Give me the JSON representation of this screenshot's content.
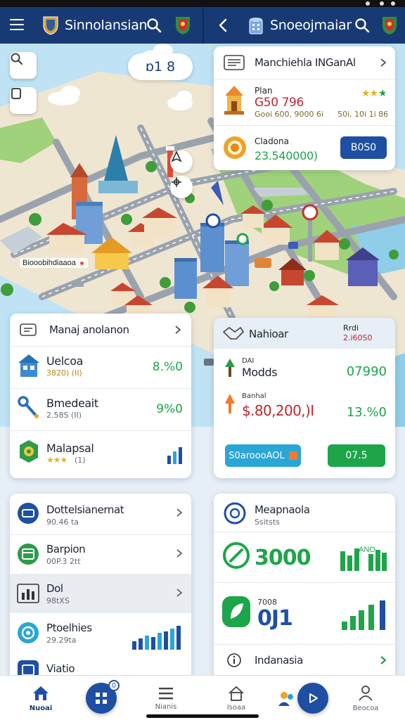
{
  "app": {
    "left_title": "Sinnolansian",
    "right_title": "Snoeojmaiar"
  },
  "map": {
    "zoom_label": "ɒ1 8",
    "place_label": "Biooobihdiaaoa"
  },
  "summary_card": {
    "header": "Manchiehla INGanAl",
    "item1_name": "Plan",
    "item1_value": "G50 796",
    "item1_sub": "Gooi 600, 9000 6i",
    "item1_right": "50i, 10i 1i 86",
    "item2_name": "Cladona",
    "item2_value": "23.540000)",
    "item2_button": "B0S0"
  },
  "manage_card": {
    "header": "Manaj anolanon",
    "rows": [
      {
        "name": "Uelcoa",
        "sub": "3820) (II)",
        "value": "8.%0"
      },
      {
        "name": "Bmedeait",
        "sub": "2.58S (II)",
        "value": "9%0"
      },
      {
        "name": "Malapsal",
        "sub": "(1)",
        "value": ""
      }
    ]
  },
  "nahioar_card": {
    "header": "Nahioar",
    "header_right_top": "Rrdi",
    "header_right_bottom": "2.i60S0",
    "row1_top": "DAI",
    "row1_name": "Modds",
    "row1_value": "07990",
    "row2_top": "Banhal",
    "row2_value": "$.80,200,)I",
    "row2_pct": "13.%0",
    "btn_left": "S0aroooAOL",
    "btn_right": "07.5"
  },
  "list_card": {
    "rows": [
      {
        "name": "Dottelsianernat",
        "sub": "90.46 ta"
      },
      {
        "name": "Barpion",
        "sub": "00P.3 2tt"
      },
      {
        "name": "Dol",
        "sub": "98tXS"
      },
      {
        "name": "Ptoelhies",
        "sub": "29.29ta"
      },
      {
        "name": "Viatio",
        "sub": ""
      }
    ]
  },
  "metrics_card": {
    "header": "Meapnaola",
    "header_sub": "Ssitsts",
    "metric1_value": "3000",
    "metric1_chart_label": "ANO",
    "metric2_top": "7008",
    "metric2_value": "0J1",
    "footer": "Indanasia"
  },
  "bottom_nav": [
    {
      "label": "Nuoai"
    },
    {
      "label": ""
    },
    {
      "label": "Nianis"
    },
    {
      "label": "Isoaa"
    },
    {
      "label": ""
    },
    {
      "label": "Beocoa"
    }
  ],
  "fab_badge": "0",
  "colors": {
    "brand_navy": "#183a74",
    "accent_blue": "#1f4fa3",
    "green": "#1ea54a",
    "red": "#c0262d",
    "cyan": "#2aa6d6",
    "orange": "#f07a2a"
  }
}
